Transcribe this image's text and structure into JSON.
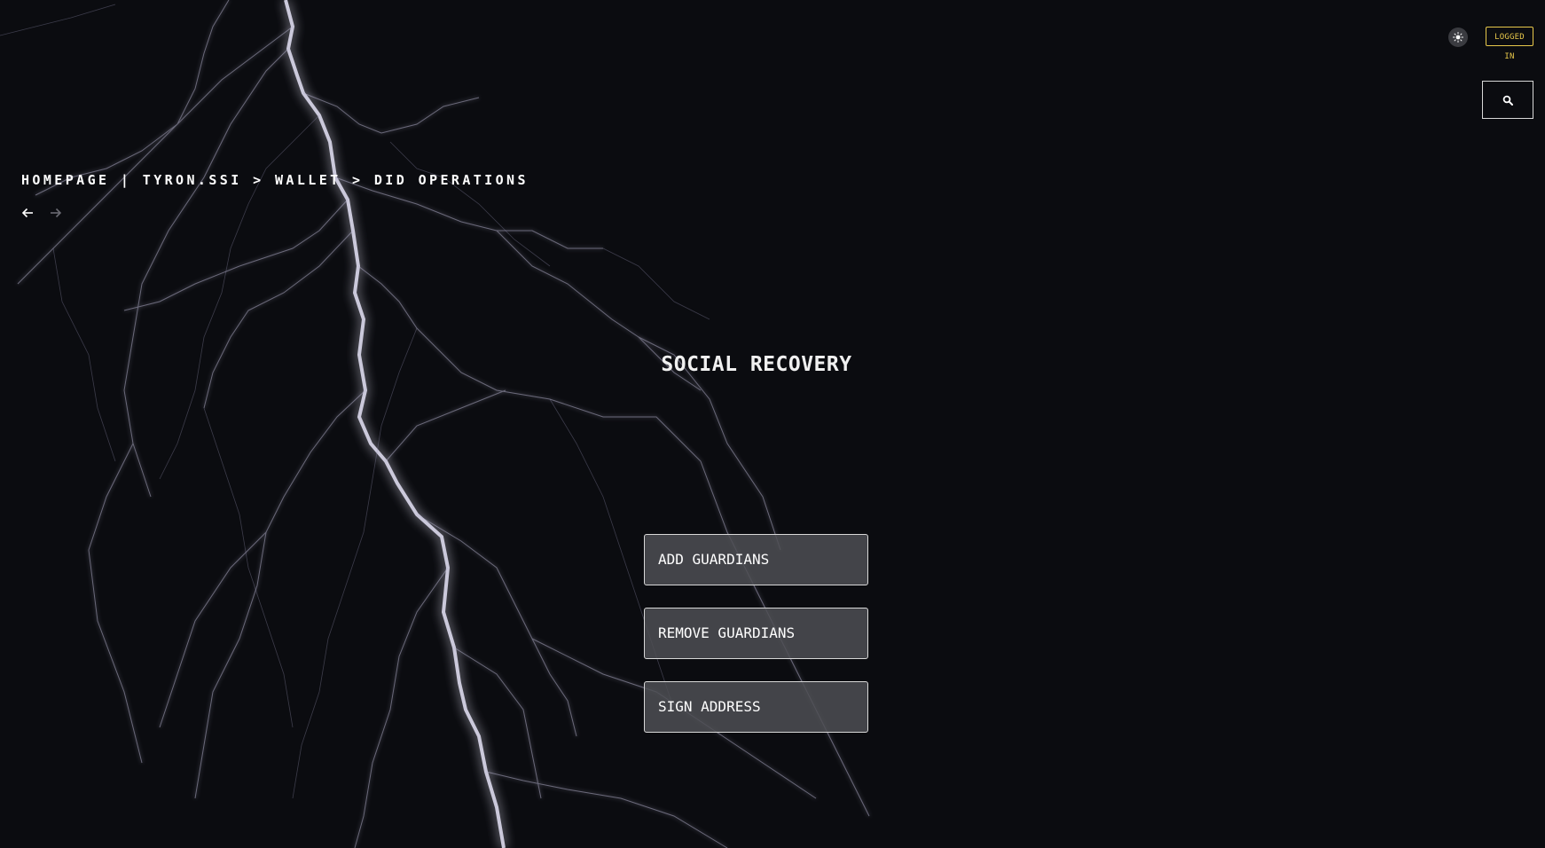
{
  "header": {
    "theme_toggle_icon": "sun-icon",
    "login_status": "LOGGED IN",
    "login_status_color": "#e8c84a",
    "search_icon": "search-icon"
  },
  "breadcrumb": {
    "items": [
      "HOMEPAGE",
      "TYRON.SSI",
      "WALLET",
      "DID OPERATIONS"
    ],
    "separators": [
      "|",
      ">",
      ">"
    ]
  },
  "nav": {
    "back_icon": "arrow-left-icon",
    "forward_icon": "arrow-right-icon"
  },
  "main": {
    "title": "SOCIAL RECOVERY",
    "options": [
      {
        "label": "ADD GUARDIANS"
      },
      {
        "label": "REMOVE GUARDIANS"
      },
      {
        "label": "SIGN ADDRESS"
      }
    ]
  },
  "colors": {
    "background": "#0b0c10",
    "accent": "#e8c84a",
    "button_bg": "#4e4f54"
  }
}
